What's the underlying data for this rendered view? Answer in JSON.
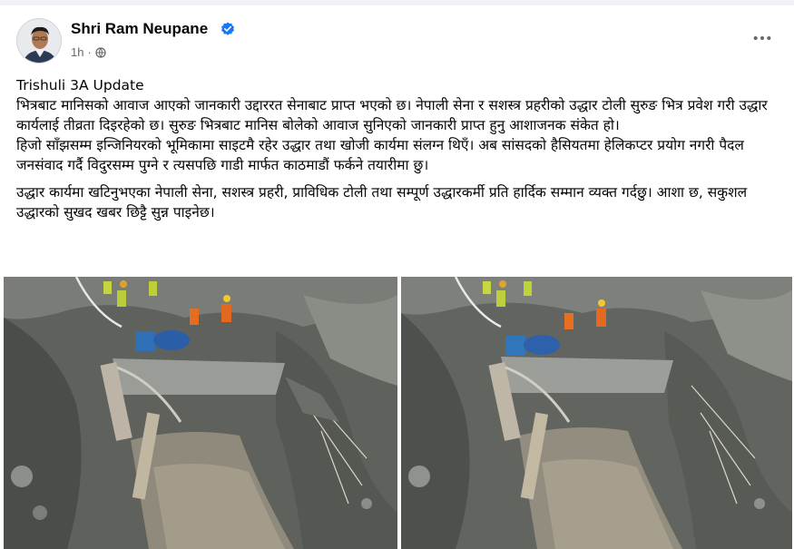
{
  "post": {
    "author": "Shri Ram Neupane",
    "time": "1h",
    "audience_icon": "globe-icon",
    "verified_icon": "verified-badge-icon",
    "more_icon": "more-options-icon",
    "accent_color": "#1877f2",
    "title_line": "Trishuli 3A Update",
    "paragraph_1": "भित्रबाट मानिसको आवाज आएको जानकारी उद्दाररत सेनाबाट प्राप्त भएको छ। नेपाली सेना र सशस्त्र प्रहरीको उद्धार टोली सुरुङ भित्र प्रवेश गरी उद्धार कार्यलाई तीव्रता दिइरहेको छ। सुरुङ भित्रबाट मानिस बोलेको आवाज सुनिएको जानकारी प्राप्त हुनु आशाजनक संकेत हो।",
    "paragraph_2": "हिजो साँझसम्म इन्जिनियरको भूमिकामा साइटमै रहेर उद्धार तथा खोजी कार्यमा संलग्न थिएँ। अब सांसदको हैसियतमा हेलिकप्टर प्रयोग नगरी पैदल जनसंवाद गर्दै विदुरसम्म पुग्ने र त्यसपछि गाडी मार्फत काठमाडौं फर्कने तयारीमा छु।",
    "paragraph_3": "उद्धार कार्यमा खटिनुभएका नेपाली सेना, सशस्त्र प्रहरी, प्राविधिक टोली तथा सम्पूर्ण उद्धारकर्मी प्रति हार्दिक सम्मान व्यक्त गर्दछु। आशा छ, सकुशल उद्धारको सुखद खबर छिट्टै सुन्न पाइनेछ।"
  },
  "photos": [
    {
      "name": "rescue-site-photo-1"
    },
    {
      "name": "rescue-site-photo-2"
    }
  ]
}
